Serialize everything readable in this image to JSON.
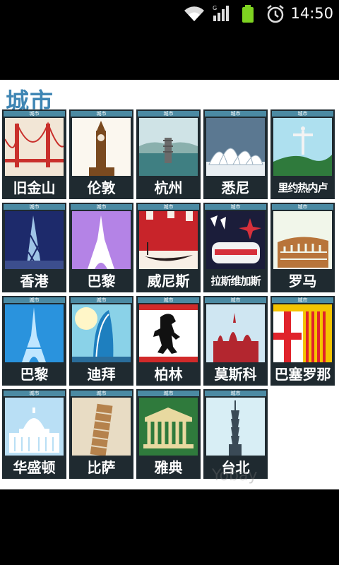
{
  "status_bar": {
    "time": "14:50",
    "icons": [
      "wifi-icon",
      "signal-icon",
      "battery-icon",
      "alarm-icon"
    ]
  },
  "page": {
    "title": "城市",
    "watermark": "Yobay"
  },
  "tiles": [
    {
      "name": "旧金山",
      "ribbon": "城市"
    },
    {
      "name": "伦敦",
      "ribbon": "城市"
    },
    {
      "name": "杭州",
      "ribbon": "城市"
    },
    {
      "name": "悉尼",
      "ribbon": "城市"
    },
    {
      "name": "里约热内卢",
      "ribbon": "城市"
    },
    {
      "name": "香港",
      "ribbon": "城市"
    },
    {
      "name": "巴黎",
      "ribbon": "城市"
    },
    {
      "name": "威尼斯",
      "ribbon": "城市"
    },
    {
      "name": "拉斯维加斯",
      "ribbon": "城市"
    },
    {
      "name": "罗马",
      "ribbon": "城市"
    },
    {
      "name": "巴黎",
      "ribbon": "城市"
    },
    {
      "name": "迪拜",
      "ribbon": "城市"
    },
    {
      "name": "柏林",
      "ribbon": "城市"
    },
    {
      "name": "莫斯科",
      "ribbon": "城市"
    },
    {
      "name": "巴塞罗那",
      "ribbon": "城市"
    },
    {
      "name": "华盛顿",
      "ribbon": "城市"
    },
    {
      "name": "比萨",
      "ribbon": "城市"
    },
    {
      "name": "雅典",
      "ribbon": "城市"
    },
    {
      "name": "台北",
      "ribbon": "城市"
    }
  ],
  "colors": {
    "title": "#3f86b4",
    "tile_frame": "#1f2a30",
    "ribbon": "#4b8aa3",
    "battery": "#7ed321"
  }
}
